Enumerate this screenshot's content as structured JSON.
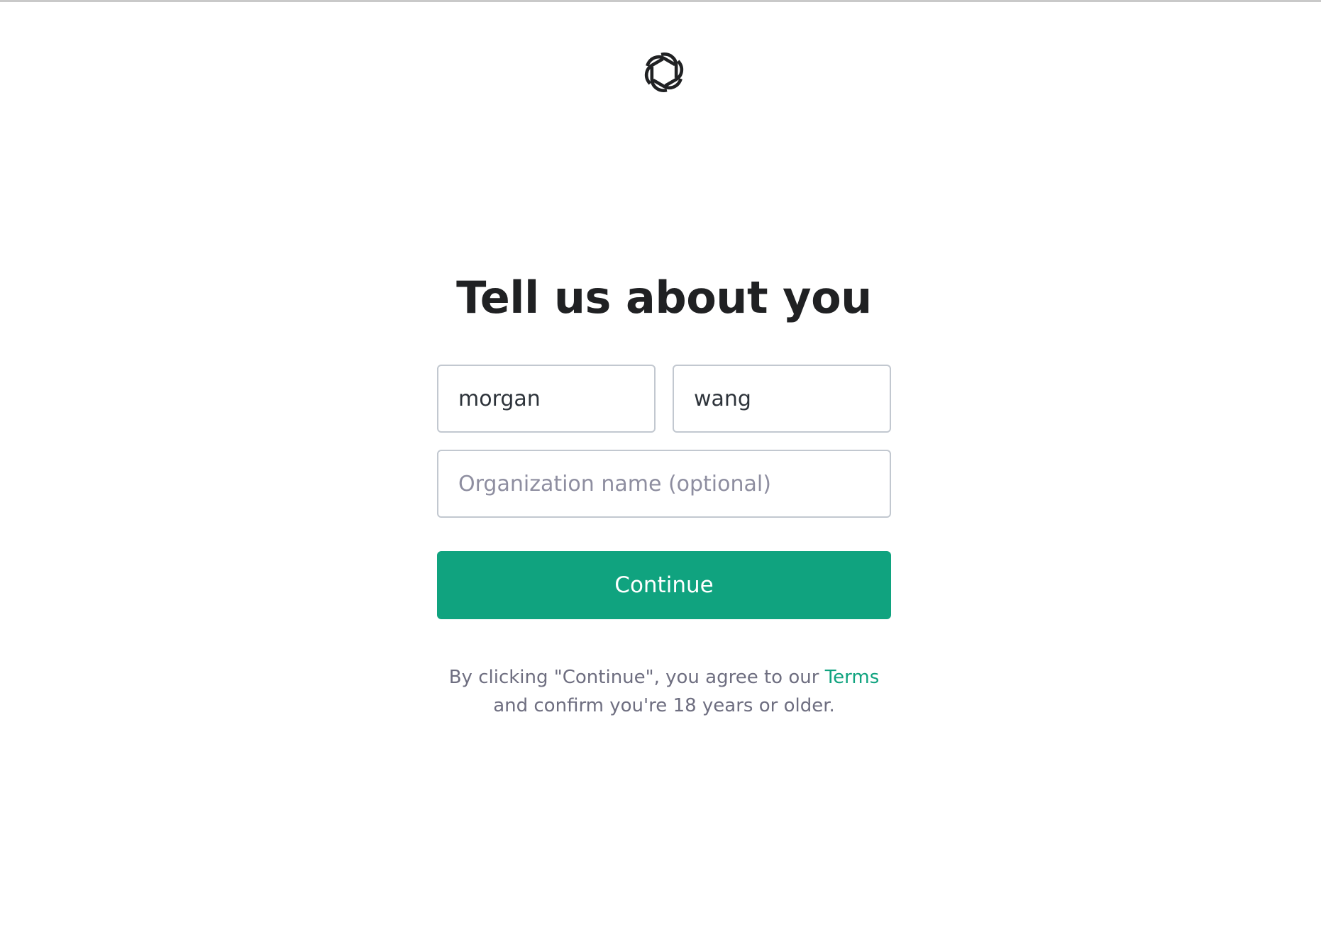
{
  "brand": {
    "logo_icon": "openai-logo-icon",
    "accent_color": "#10a37f"
  },
  "heading": {
    "title": "Tell us about you"
  },
  "form": {
    "first_name": {
      "value": "morgan",
      "placeholder": ""
    },
    "last_name": {
      "value": "wang",
      "placeholder": ""
    },
    "organization": {
      "value": "",
      "placeholder": "Organization name (optional)"
    },
    "continue_label": "Continue"
  },
  "legal": {
    "prefix": "By clicking \"Continue\", you agree to our ",
    "terms_link": "Terms",
    "suffix": "and confirm you're 18 years or older."
  }
}
